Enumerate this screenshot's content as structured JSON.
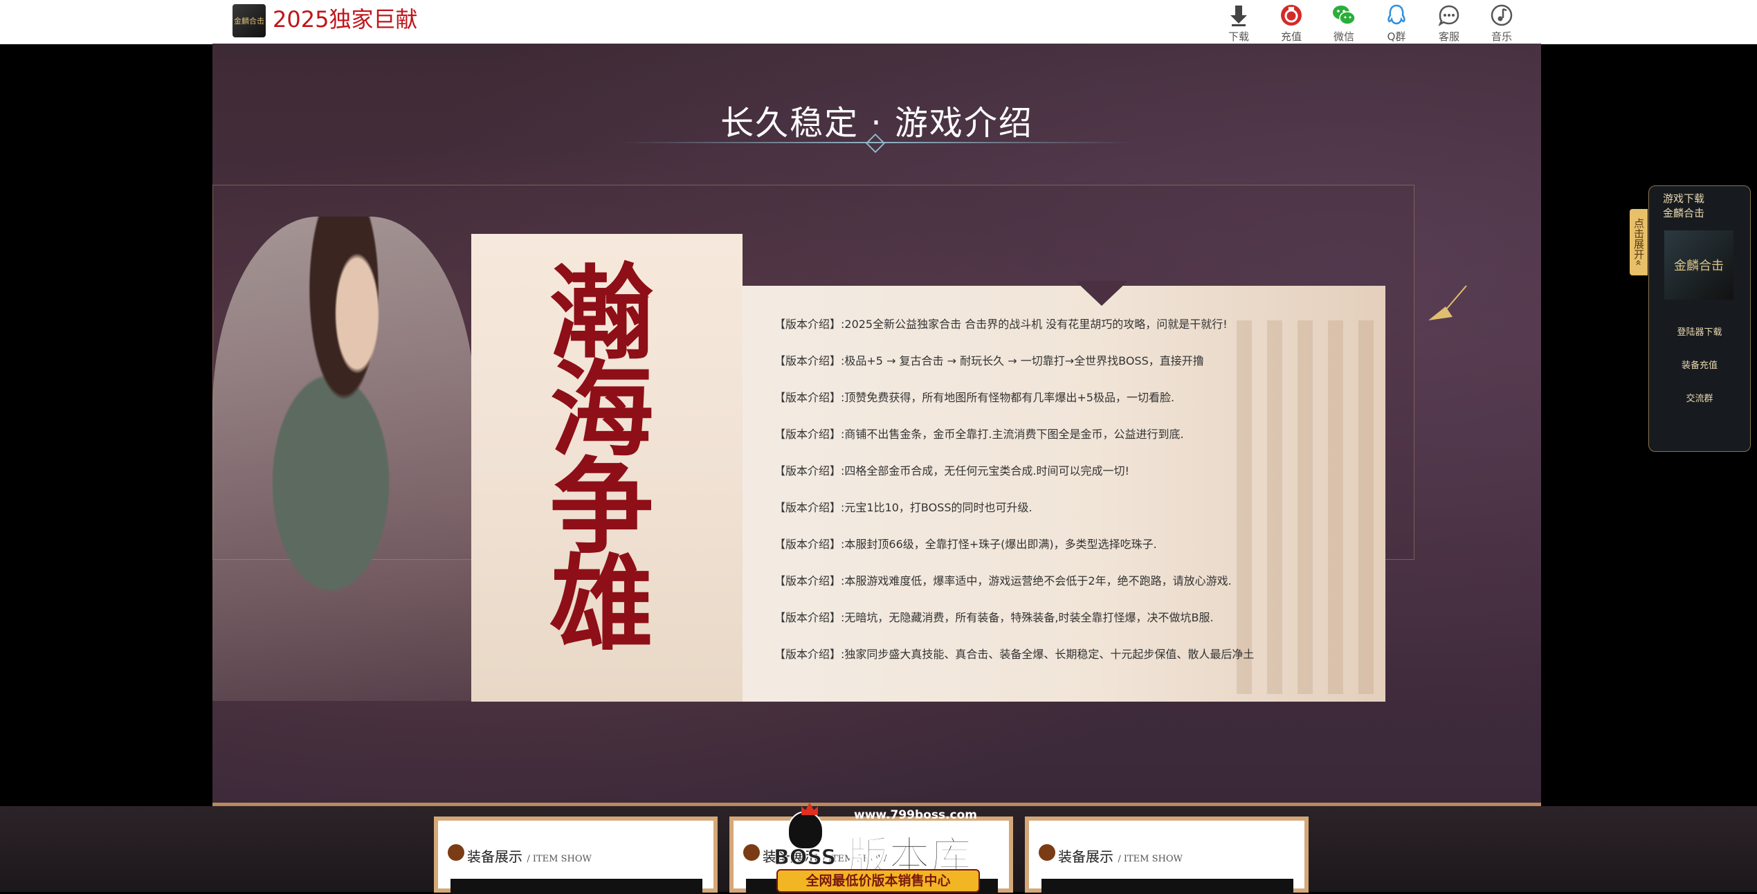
{
  "header": {
    "logo_text": "金麟合击",
    "site_title": "2025独家巨献",
    "nav": [
      {
        "label": "下载",
        "icon": "download-icon"
      },
      {
        "label": "充值",
        "icon": "recharge-icon"
      },
      {
        "label": "微信",
        "icon": "wechat-icon"
      },
      {
        "label": "Q群",
        "icon": "qq-icon"
      },
      {
        "label": "客服",
        "icon": "customer-service-icon"
      },
      {
        "label": "音乐",
        "icon": "music-icon"
      }
    ]
  },
  "section": {
    "title": "长久稳定 · 游戏介绍",
    "calligraphy": "瀚海争雄",
    "intro_items": [
      "【版本介绍】:2025全新公益独家合击 合击界的战斗机 没有花里胡巧的攻略，问就是干就行!",
      "【版本介绍】:极品+5 → 复古合击 → 耐玩长久 → 一切靠打→全世界找BOSS，直接开撸",
      "【版本介绍】:顶赞免费获得，所有地图所有怪物都有几率爆出+5极品，一切看脸.",
      "【版本介绍】:商铺不出售金条，金币全靠打.主流消费下图全是金币，公益进行到底.",
      "【版本介绍】:四格全部金币合成，无任何元宝类合成.时间可以完成一切!",
      "【版本介绍】:元宝1比10，打BOSS的同时也可升级.",
      "【版本介绍】:本服封顶66级，全靠打怪+珠子(爆出即满)，多类型选择吃珠子.",
      "【版本介绍】:本服游戏难度低，爆率适中，游戏运营绝不会低于2年，绝不跑路，请放心游戏.",
      "【版本介绍】:无暗坑，无隐藏消费，所有装备，特殊装备,时装全靠打怪爆，决不做坑B服.",
      "【版本介绍】:独家同步盛大真技能、真合击、装备全爆、长期稳定、十元起步保值、散人最后净土"
    ]
  },
  "side_panel": {
    "expand_label": "点击展开«",
    "title_line1": "游戏下载",
    "title_line2": "金麟合击",
    "thumb_text": "金麟合击",
    "links": [
      "登陆器下载",
      "装备充值",
      "交流群"
    ]
  },
  "cards": [
    {
      "title": "装备展示",
      "subtitle": "/ ITEM SHOW"
    },
    {
      "title": "装备展示",
      "subtitle": "/ ITEM SHOW"
    },
    {
      "title": "装备展示",
      "subtitle": "/ ITEM SHOW"
    }
  ],
  "watermark": {
    "url": "www.799boss.com",
    "name": "版本库",
    "boss": "BOSS",
    "tagline": "全网最低价版本销售中心"
  }
}
